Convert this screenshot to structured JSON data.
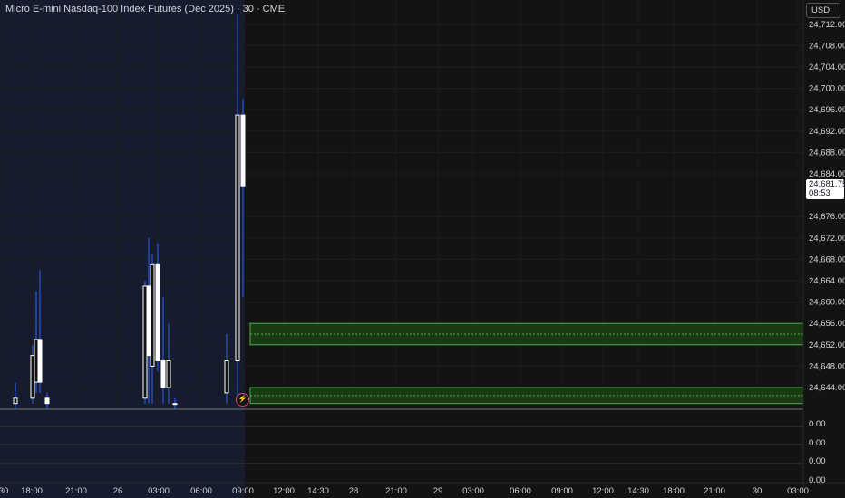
{
  "header": {
    "title": "Micro E-mini Nasdaq-100 Index Futures (Dec 2025) · 30 · CME",
    "currency": "USD"
  },
  "price_axis": {
    "labels": [
      "24,712.00",
      "24,708.00",
      "24,704.00",
      "24,700.00",
      "24,696.00",
      "24,692.00",
      "24,688.00",
      "24,684.00",
      "24,676.00",
      "24,672.00",
      "24,668.00",
      "24,664.00",
      "24,660.00",
      "24,656.00",
      "24,652.00",
      "24,648.00",
      "24,644.00"
    ],
    "current_price": "24,681.75",
    "countdown": "08:53"
  },
  "time_axis": {
    "labels": [
      "30",
      "18:00",
      "21:00",
      "26",
      "03:00",
      "06:00",
      "09:00",
      "12:00",
      "14:30",
      "28",
      "21:00",
      "29",
      "03:00",
      "06:00",
      "09:00",
      "12:00",
      "14:30",
      "18:00",
      "21:00",
      "30",
      "03:00"
    ]
  },
  "indicator_panes": {
    "values": [
      "0.00",
      "0.00",
      "0.00",
      "0.00"
    ]
  },
  "colors": {
    "background": "#131313",
    "session_shade": "#161c2e",
    "candle_up": "#ffffff",
    "wick": "#2962ff",
    "zone_fill": "#1a3a14",
    "zone_border": "#4caf50",
    "alert": "#e0457b"
  },
  "chart_data": {
    "type": "candlestick",
    "symbol": "MNQ Dec 2025",
    "interval": "30",
    "y_range": [
      24640,
      24714
    ],
    "candles": [
      {
        "t": "18:00",
        "o": 24641,
        "h": 24645,
        "l": 24640,
        "c": 24642
      },
      {
        "t": "18:30",
        "o": 24642,
        "h": 24652,
        "l": 24641,
        "c": 24650
      },
      {
        "t": "19:00",
        "o": 24645,
        "h": 24662,
        "l": 24643,
        "c": 24653
      },
      {
        "t": "19:30",
        "o": 24653,
        "h": 24666,
        "l": 24643,
        "c": 24645
      },
      {
        "t": "20:00",
        "o": 24642,
        "h": 24643,
        "l": 24640,
        "c": 24641
      },
      {
        "t": "02:30",
        "o": 24642,
        "h": 24664,
        "l": 24641,
        "c": 24663
      },
      {
        "t": "03:00",
        "o": 24663,
        "h": 24672,
        "l": 24641,
        "c": 24650
      },
      {
        "t": "03:30",
        "o": 24648,
        "h": 24669,
        "l": 24641,
        "c": 24667
      },
      {
        "t": "04:00",
        "o": 24667,
        "h": 24671,
        "l": 24647,
        "c": 24649
      },
      {
        "t": "04:30",
        "o": 24649,
        "h": 24661,
        "l": 24641,
        "c": 24644
      },
      {
        "t": "05:00",
        "o": 24644,
        "h": 24656,
        "l": 24641,
        "c": 24649
      },
      {
        "t": "05:30",
        "o": 24641,
        "h": 24642,
        "l": 24640,
        "c": 24641
      },
      {
        "t": "08:30",
        "o": 24643,
        "h": 24654,
        "l": 24641,
        "c": 24649
      },
      {
        "t": "09:00",
        "o": 24649,
        "h": 24714,
        "l": 24642,
        "c": 24695
      },
      {
        "t": "09:30",
        "o": 24695,
        "h": 24698,
        "l": 24661,
        "c": 24681.75
      }
    ],
    "zones": [
      {
        "top": 24656,
        "bottom": 24652,
        "mid": 24654
      },
      {
        "top": 24644,
        "bottom": 24641,
        "mid": 24642.5
      }
    ]
  }
}
